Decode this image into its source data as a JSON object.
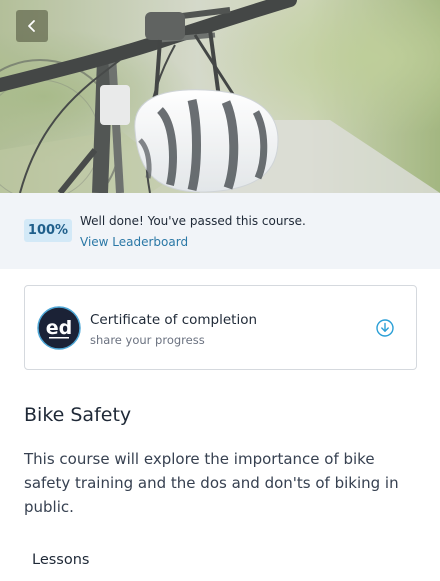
{
  "header": {
    "back_icon": "chevron-left-icon",
    "hero_image": "bicycle-handlebars-with-helmet"
  },
  "banner": {
    "score": "100%",
    "message": "Well done! You've passed this course.",
    "link": "View Leaderboard"
  },
  "certificate": {
    "logo_icon": "ed-logo-icon",
    "title": "Certificate of completion",
    "subtitle": "share your progress",
    "action_icon": "download-icon"
  },
  "course": {
    "title": "Bike Safety",
    "description": "This course will explore the importance of bike safety training and the dos and don'ts of biking in public."
  },
  "lessons": {
    "heading": "Lessons"
  },
  "colors": {
    "accent": "#2b78a6",
    "badge_bg": "#d3e9f7",
    "banner_bg": "#f1f4f8"
  }
}
